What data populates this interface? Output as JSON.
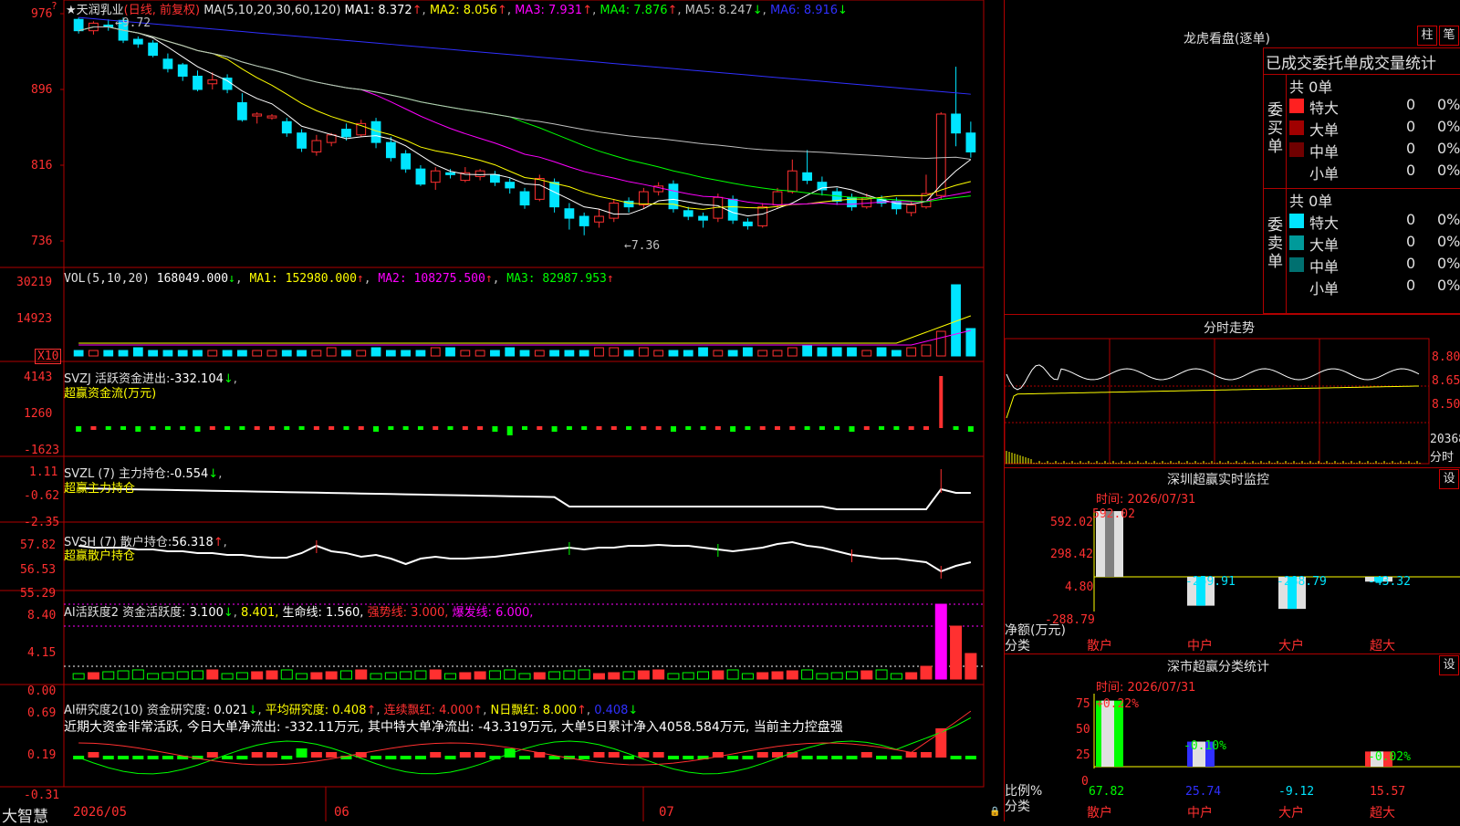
{
  "colors": {
    "up": "#ff3030",
    "down": "#00e5ff",
    "ma1": "#ffffff",
    "ma2": "#ffff00",
    "ma3": "#ff00ff",
    "ma4": "#00ff00",
    "ma5": "#c0c0c0",
    "ma6": "#3030ff",
    "grid": "#b00000"
  },
  "main": {
    "stock_name": "★天润乳业",
    "period": "(日线, 前复权)",
    "ma_label": "MA(5,10,20,30,60,120)",
    "ma1": "MA1: 8.372",
    "ma2": "MA2: 8.056",
    "ma3": "MA3: 7.931",
    "ma4": "MA4: 7.876",
    "ma5": "MA5: 8.247",
    "ma6": "MA6: 8.916",
    "y_ticks": [
      "976",
      "896",
      "816",
      "736"
    ],
    "high_note": "←9.72",
    "low_note": "←7.36"
  },
  "vol": {
    "label": "VOL(5,10,20)",
    "value": "168049.000",
    "ma1": "MA1: 152980.000",
    "ma2": "MA2: 108275.500",
    "ma3": "MA3: 82987.953",
    "y_ticks": [
      "30219",
      "14923"
    ],
    "unit": "X10"
  },
  "svzj": {
    "label": "SVZJ  活跃资金进出:",
    "value": "-332.104",
    "sub": "超赢资金流(万元)",
    "y_ticks": [
      "4143",
      "1260",
      "-1623"
    ]
  },
  "svzl": {
    "label": "SVZL (7) 主力持仓:",
    "value": "-0.554",
    "sub": "超赢主力持仓",
    "y_ticks": [
      "1.11",
      "-0.62",
      "-2.35"
    ]
  },
  "svsh": {
    "label": "SVSH (7) 散户持仓:",
    "value": "56.318",
    "sub": "超赢散户持仓",
    "y_ticks": [
      "57.82",
      "56.53",
      "55.29"
    ]
  },
  "ai1": {
    "label": "AI活跃度2 资金活跃度:",
    "value": "3.100",
    "v2": "8.401,",
    "life": "生命线: 1.560,",
    "strong": "强势线: 3.000,",
    "burst": "爆发线: 6.000,",
    "y_ticks": [
      "8.40",
      "4.15",
      "0.00"
    ]
  },
  "ai2": {
    "label": "AI研究度2(10) 资金研究度:",
    "value": "0.021",
    "avg": "平均研究度: 0.408",
    "streak": "连续飘红: 4.000",
    "n": "N日飘红: 8.000",
    "last": "0.408",
    "comment": "近期大资金非常活跃, 今日大单净流出: -332.11万元, 其中特大单净流出: -43.319万元, 大单5日累计净入4058.584万元, 当前主力控盘强",
    "y_ticks": [
      "0.69",
      "0.19",
      "-0.31"
    ]
  },
  "bottom": {
    "brand": "大智慧",
    "dates": [
      "2026/05",
      "06",
      "07"
    ]
  },
  "dragon": {
    "title": "龙虎看盘(逐单)",
    "btn1": "柱",
    "btn2": "笔",
    "header": "已成交委托单成交量统计",
    "buy_label": "委买单",
    "sell_label": "委卖单",
    "buy_total": "共 0单",
    "sell_total": "共 0单",
    "rows": [
      {
        "name": "特大",
        "val": "0",
        "pct": "0%"
      },
      {
        "name": "大单",
        "val": "0",
        "pct": "0%"
      },
      {
        "name": "中单",
        "val": "0",
        "pct": "0%"
      },
      {
        "name": "小单",
        "val": "0",
        "pct": "0%"
      }
    ]
  },
  "intraday": {
    "title": "分时走势",
    "y_ticks": [
      "8.80",
      "8.65",
      "8.50"
    ],
    "vol_tick": "20368",
    "vol_unit": "分时"
  },
  "monitor": {
    "title": "深圳超赢实时监控",
    "btn": "设",
    "time": "时间: 2026/07/31",
    "y_ticks": [
      "592.02",
      "298.42",
      "4.80",
      "-288.79"
    ],
    "bars": [
      {
        "name": "散户",
        "value": "592.02"
      },
      {
        "name": "中户",
        "value": "-259.91"
      },
      {
        "name": "大户",
        "value": "-288.79"
      },
      {
        "name": "超大",
        "value": "-43.32"
      }
    ],
    "axis_label": "净额(万元)",
    "cat_label": "分类"
  },
  "classify": {
    "title": "深市超赢分类统计",
    "btn": "设",
    "time": "时间: 2026/07/31",
    "y_ticks": [
      "75",
      "50",
      "25",
      "0"
    ],
    "bars": [
      {
        "name": "散户",
        "value": "67.82",
        "change": "+0.22%"
      },
      {
        "name": "中户",
        "value": "25.74",
        "change": "-0.10%"
      },
      {
        "name": "大户",
        "value": "-9.12",
        "change": ""
      },
      {
        "name": "超大",
        "value": "15.57",
        "change": "-0.02%"
      }
    ],
    "axis_label": "比例%",
    "cat_label": "分类"
  }
}
